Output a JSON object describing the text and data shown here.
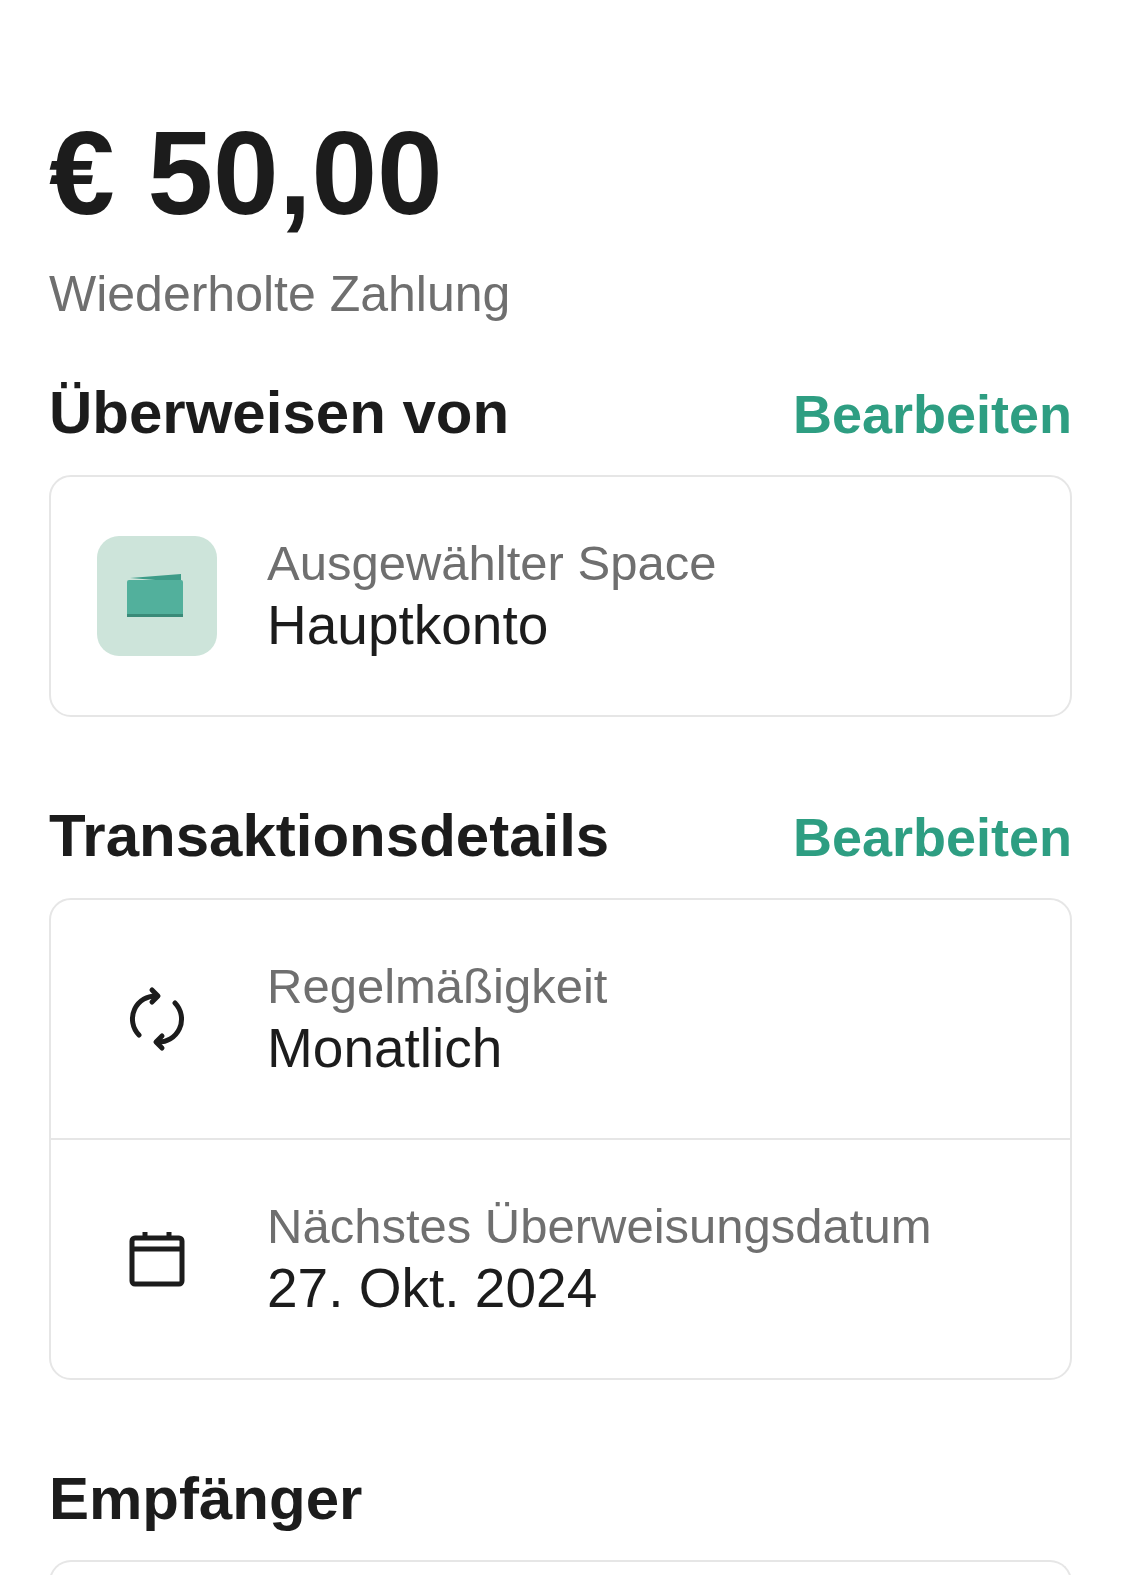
{
  "amount": "€ 50,00",
  "subtitle": "Wiederholte Zahlung",
  "sections": [
    {
      "title": "Überweisen von",
      "action": "Bearbeiten",
      "rows": [
        {
          "kind": "wallet",
          "label": "Ausgewählter Space",
          "value": "Hauptkonto"
        }
      ]
    },
    {
      "title": "Transaktionsdetails",
      "action": "Bearbeiten",
      "rows": [
        {
          "kind": "repeat",
          "label": "Regelmäßigkeit",
          "value": "Monatlich"
        },
        {
          "kind": "calendar",
          "label": "Nächstes Überweisungsdatum",
          "value": "27. Okt. 2024"
        }
      ]
    },
    {
      "title": "Empfänger"
    }
  ]
}
